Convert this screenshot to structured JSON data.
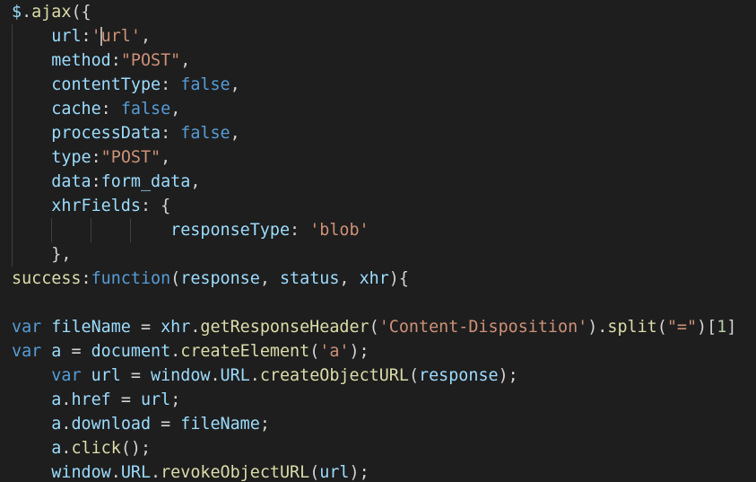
{
  "colors": {
    "background": "#1e1e1e",
    "text": "#d4d4d4",
    "variable": "#9cdcfe",
    "function": "#dcdcaa",
    "string": "#ce9178",
    "keyword": "#569cd6",
    "number": "#b5cea8",
    "indent_guide": "#404040",
    "cursor": "#aeafad"
  },
  "editor": {
    "language": "javascript",
    "lines": [
      [
        [
          "variable",
          "$"
        ],
        [
          "text",
          "."
        ],
        [
          "function",
          "ajax"
        ],
        [
          "text",
          "({"
        ]
      ],
      [
        [
          "text",
          "    "
        ],
        [
          "variable",
          "url"
        ],
        [
          "text",
          ":"
        ],
        [
          "string",
          "'url'"
        ],
        [
          "text",
          ","
        ]
      ],
      [
        [
          "text",
          "    "
        ],
        [
          "variable",
          "method"
        ],
        [
          "text",
          ":"
        ],
        [
          "string",
          "\"POST\""
        ],
        [
          "text",
          ","
        ]
      ],
      [
        [
          "text",
          "    "
        ],
        [
          "variable",
          "contentType"
        ],
        [
          "text",
          ": "
        ],
        [
          "keyword",
          "false"
        ],
        [
          "text",
          ","
        ]
      ],
      [
        [
          "text",
          "    "
        ],
        [
          "variable",
          "cache"
        ],
        [
          "text",
          ": "
        ],
        [
          "keyword",
          "false"
        ],
        [
          "text",
          ","
        ]
      ],
      [
        [
          "text",
          "    "
        ],
        [
          "variable",
          "processData"
        ],
        [
          "text",
          ": "
        ],
        [
          "keyword",
          "false"
        ],
        [
          "text",
          ","
        ]
      ],
      [
        [
          "text",
          "    "
        ],
        [
          "variable",
          "type"
        ],
        [
          "text",
          ":"
        ],
        [
          "string",
          "\"POST\""
        ],
        [
          "text",
          ","
        ]
      ],
      [
        [
          "text",
          "    "
        ],
        [
          "variable",
          "data"
        ],
        [
          "text",
          ":"
        ],
        [
          "variable",
          "form_data"
        ],
        [
          "text",
          ","
        ]
      ],
      [
        [
          "text",
          "    "
        ],
        [
          "variable",
          "xhrFields"
        ],
        [
          "text",
          ": {"
        ]
      ],
      [
        [
          "text",
          "                "
        ],
        [
          "variable",
          "responseType"
        ],
        [
          "text",
          ": "
        ],
        [
          "string",
          "'blob'"
        ]
      ],
      [
        [
          "text",
          "    },"
        ]
      ],
      [
        [
          "function",
          "success"
        ],
        [
          "text",
          ":"
        ],
        [
          "keyword",
          "function"
        ],
        [
          "text",
          "("
        ],
        [
          "variable",
          "response"
        ],
        [
          "text",
          ", "
        ],
        [
          "variable",
          "status"
        ],
        [
          "text",
          ", "
        ],
        [
          "variable",
          "xhr"
        ],
        [
          "text",
          "){"
        ]
      ],
      [],
      [
        [
          "keyword",
          "var"
        ],
        [
          "text",
          " "
        ],
        [
          "variable",
          "fileName"
        ],
        [
          "text",
          " = "
        ],
        [
          "variable",
          "xhr"
        ],
        [
          "text",
          "."
        ],
        [
          "function",
          "getResponseHeader"
        ],
        [
          "text",
          "("
        ],
        [
          "string",
          "'Content-Disposition'"
        ],
        [
          "text",
          ")."
        ],
        [
          "function",
          "split"
        ],
        [
          "text",
          "("
        ],
        [
          "string",
          "\"=\""
        ],
        [
          "text",
          ")["
        ],
        [
          "number",
          "1"
        ],
        [
          "text",
          "]"
        ]
      ],
      [
        [
          "keyword",
          "var"
        ],
        [
          "text",
          " "
        ],
        [
          "variable",
          "a"
        ],
        [
          "text",
          " = "
        ],
        [
          "variable",
          "document"
        ],
        [
          "text",
          "."
        ],
        [
          "function",
          "createElement"
        ],
        [
          "text",
          "("
        ],
        [
          "string",
          "'a'"
        ],
        [
          "text",
          ");"
        ]
      ],
      [
        [
          "text",
          "    "
        ],
        [
          "keyword",
          "var"
        ],
        [
          "text",
          " "
        ],
        [
          "variable",
          "url"
        ],
        [
          "text",
          " = "
        ],
        [
          "variable",
          "window"
        ],
        [
          "text",
          "."
        ],
        [
          "variable",
          "URL"
        ],
        [
          "text",
          "."
        ],
        [
          "function",
          "createObjectURL"
        ],
        [
          "text",
          "("
        ],
        [
          "variable",
          "response"
        ],
        [
          "text",
          ");"
        ]
      ],
      [
        [
          "text",
          "    "
        ],
        [
          "variable",
          "a"
        ],
        [
          "text",
          "."
        ],
        [
          "variable",
          "href"
        ],
        [
          "text",
          " = "
        ],
        [
          "variable",
          "url"
        ],
        [
          "text",
          ";"
        ]
      ],
      [
        [
          "text",
          "    "
        ],
        [
          "variable",
          "a"
        ],
        [
          "text",
          "."
        ],
        [
          "variable",
          "download"
        ],
        [
          "text",
          " = "
        ],
        [
          "variable",
          "fileName"
        ],
        [
          "text",
          ";"
        ]
      ],
      [
        [
          "text",
          "    "
        ],
        [
          "variable",
          "a"
        ],
        [
          "text",
          "."
        ],
        [
          "function",
          "click"
        ],
        [
          "text",
          "();"
        ]
      ],
      [
        [
          "text",
          "    "
        ],
        [
          "variable",
          "window"
        ],
        [
          "text",
          "."
        ],
        [
          "variable",
          "URL"
        ],
        [
          "text",
          "."
        ],
        [
          "function",
          "revokeObjectURL"
        ],
        [
          "text",
          "("
        ],
        [
          "variable",
          "url"
        ],
        [
          "text",
          ");"
        ]
      ]
    ]
  }
}
